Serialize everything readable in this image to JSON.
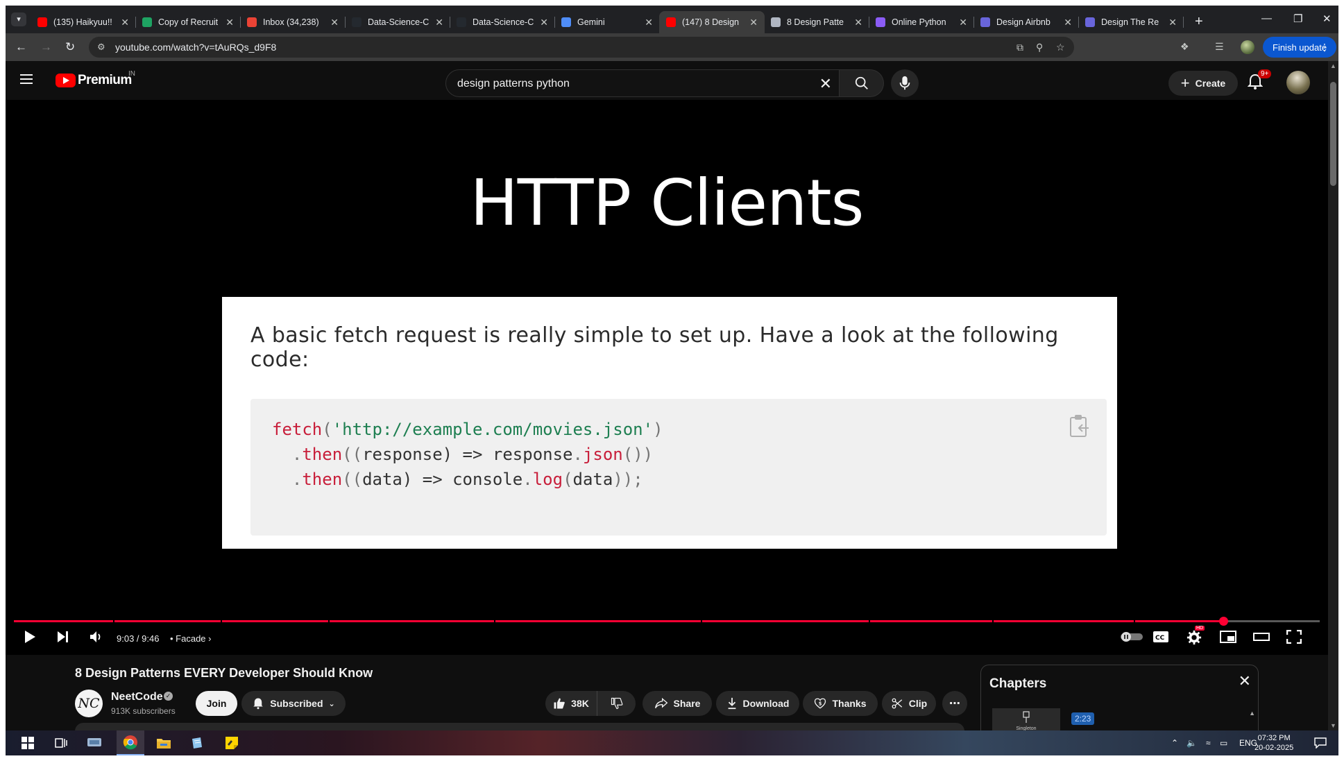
{
  "browser": {
    "tabs": [
      {
        "title": "(135) Haikyuu!!",
        "favicon": "youtube-icon",
        "color": "#ff0000",
        "active": false
      },
      {
        "title": "Copy of Recruit",
        "favicon": "sheets-icon",
        "color": "#1ea362",
        "active": false
      },
      {
        "title": "Inbox (34,238)",
        "favicon": "gmail-icon",
        "color": "#ea4335",
        "active": false
      },
      {
        "title": "Data-Science-C",
        "favicon": "github-icon",
        "color": "#24292f",
        "active": false
      },
      {
        "title": "Data-Science-C",
        "favicon": "github-icon",
        "color": "#24292f",
        "active": false
      },
      {
        "title": "Gemini",
        "favicon": "gemini-icon",
        "color": "#4f8df8",
        "active": false
      },
      {
        "title": "(147) 8 Design",
        "favicon": "youtube-icon",
        "color": "#ff0000",
        "active": true
      },
      {
        "title": "8 Design Patte",
        "favicon": "pin-icon",
        "color": "#b0b6c2",
        "active": false
      },
      {
        "title": "Online Python",
        "favicon": "python-icon",
        "color": "#8b5cf6",
        "active": false
      },
      {
        "title": "Design Airbnb",
        "favicon": "excalidraw-icon",
        "color": "#6965db",
        "active": false
      },
      {
        "title": "Design The Re",
        "favicon": "excalidraw-icon",
        "color": "#6965db",
        "active": false
      }
    ],
    "url": "youtube.com/watch?v=tAuRQs_d9F8",
    "finish_update_label": "Finish update"
  },
  "youtube": {
    "brand": "Premium",
    "country_code": "IN",
    "search_query": "design patterns python",
    "create_label": "Create",
    "notification_count": "9+"
  },
  "video_frame": {
    "title": "HTTP Clients",
    "paragraph": "A basic fetch request is really simple to set up. Have a look at the following code:",
    "code_line_1_fn": "fetch",
    "code_line_1_open": "(",
    "code_line_1_str": "'http://example.com/movies.json'",
    "code_line_1_close": ")",
    "code_line_2_dot": ".",
    "code_line_2_fn": "then",
    "code_line_2_open": "((",
    "code_line_2_param": "response",
    "code_line_2_mid": ") => response",
    "code_line_2_dot2": ".",
    "code_line_2_fn2": "json",
    "code_line_2_close": "())",
    "code_line_3_dot": ".",
    "code_line_3_fn": "then",
    "code_line_3_open": "((",
    "code_line_3_param": "data",
    "code_line_3_mid": ") => console",
    "code_line_3_dot2": ".",
    "code_line_3_fn2": "log",
    "code_line_3_open2": "(",
    "code_line_3_arg": "data",
    "code_line_3_close": "));"
  },
  "player": {
    "current_time": "9:03",
    "duration": "9:46",
    "time_display": "9:03 / 9:46",
    "chapter": "Facade",
    "progress_fraction": 0.926,
    "progress_color": "#ff0033",
    "hd_badge": "HD"
  },
  "video": {
    "title": "8 Design Patterns EVERY Developer Should Know",
    "channel": "NeetCode",
    "channel_initials": "NC",
    "subscribers": "913K subscribers",
    "join_label": "Join",
    "subscribed_label": "Subscribed",
    "likes": "38K",
    "share_label": "Share",
    "download_label": "Download",
    "thanks_label": "Thanks",
    "clip_label": "Clip"
  },
  "chapters": {
    "header": "Chapters",
    "first_thumb_caption": "Singleton",
    "first_timestamp": "2:23"
  },
  "taskbar": {
    "language": "ENG",
    "time": "07:32 PM",
    "date": "20-02-2025"
  }
}
